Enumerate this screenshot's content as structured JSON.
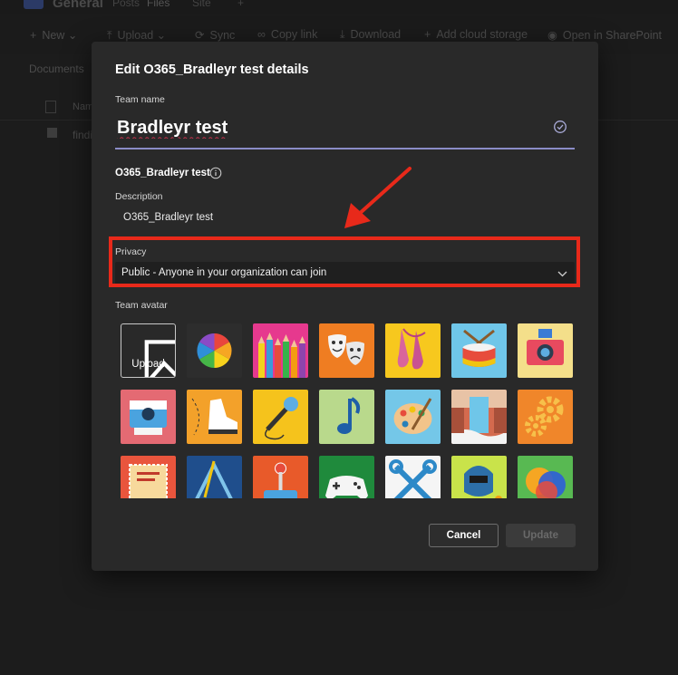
{
  "background": {
    "app_title": "General",
    "tabs": [
      "Posts",
      "Files",
      "Site",
      "+"
    ],
    "toolbar": [
      {
        "icon": "plus-icon",
        "label": "New",
        "has_dropdown": true
      },
      {
        "icon": "upload-icon",
        "label": "Upload",
        "has_dropdown": true
      },
      {
        "icon": "sync-icon",
        "label": "Sync"
      },
      {
        "icon": "link-icon",
        "label": "Copy link"
      },
      {
        "icon": "download-icon",
        "label": "Download"
      },
      {
        "icon": "plus-icon",
        "label": "Add cloud storage"
      },
      {
        "icon": "sharepoint-icon",
        "label": "Open in SharePoint"
      }
    ],
    "breadcrumb": "Documents",
    "column_header": "Nam",
    "row_text": "findi"
  },
  "dialog": {
    "title": "Edit O365_Bradleyr test details",
    "team_name_label": "Team name",
    "team_name_value": "Bradleyr test",
    "group_name": "O365_Bradleyr test",
    "description_label": "Description",
    "description_value": "O365_Bradleyr test",
    "privacy_label": "Privacy",
    "privacy_value": "Public - Anyone in your organization can join",
    "avatar_label": "Team avatar",
    "upload_label": "Upload",
    "avatars": [
      "color-wheel",
      "pencils",
      "theater-masks",
      "ballet-shoes",
      "drum",
      "camera",
      "instant-camera",
      "sneaker",
      "microphone",
      "music-note",
      "paint-palette",
      "waterfall",
      "gears",
      "stamp",
      "drafting-tools",
      "joystick",
      "game-controller",
      "tools",
      "welder",
      "color-circles"
    ],
    "cancel_label": "Cancel",
    "update_label": "Update"
  },
  "colors": {
    "dialog_bg": "#292929",
    "accent": "#8b8cc7",
    "annotation": "#e8291a"
  }
}
